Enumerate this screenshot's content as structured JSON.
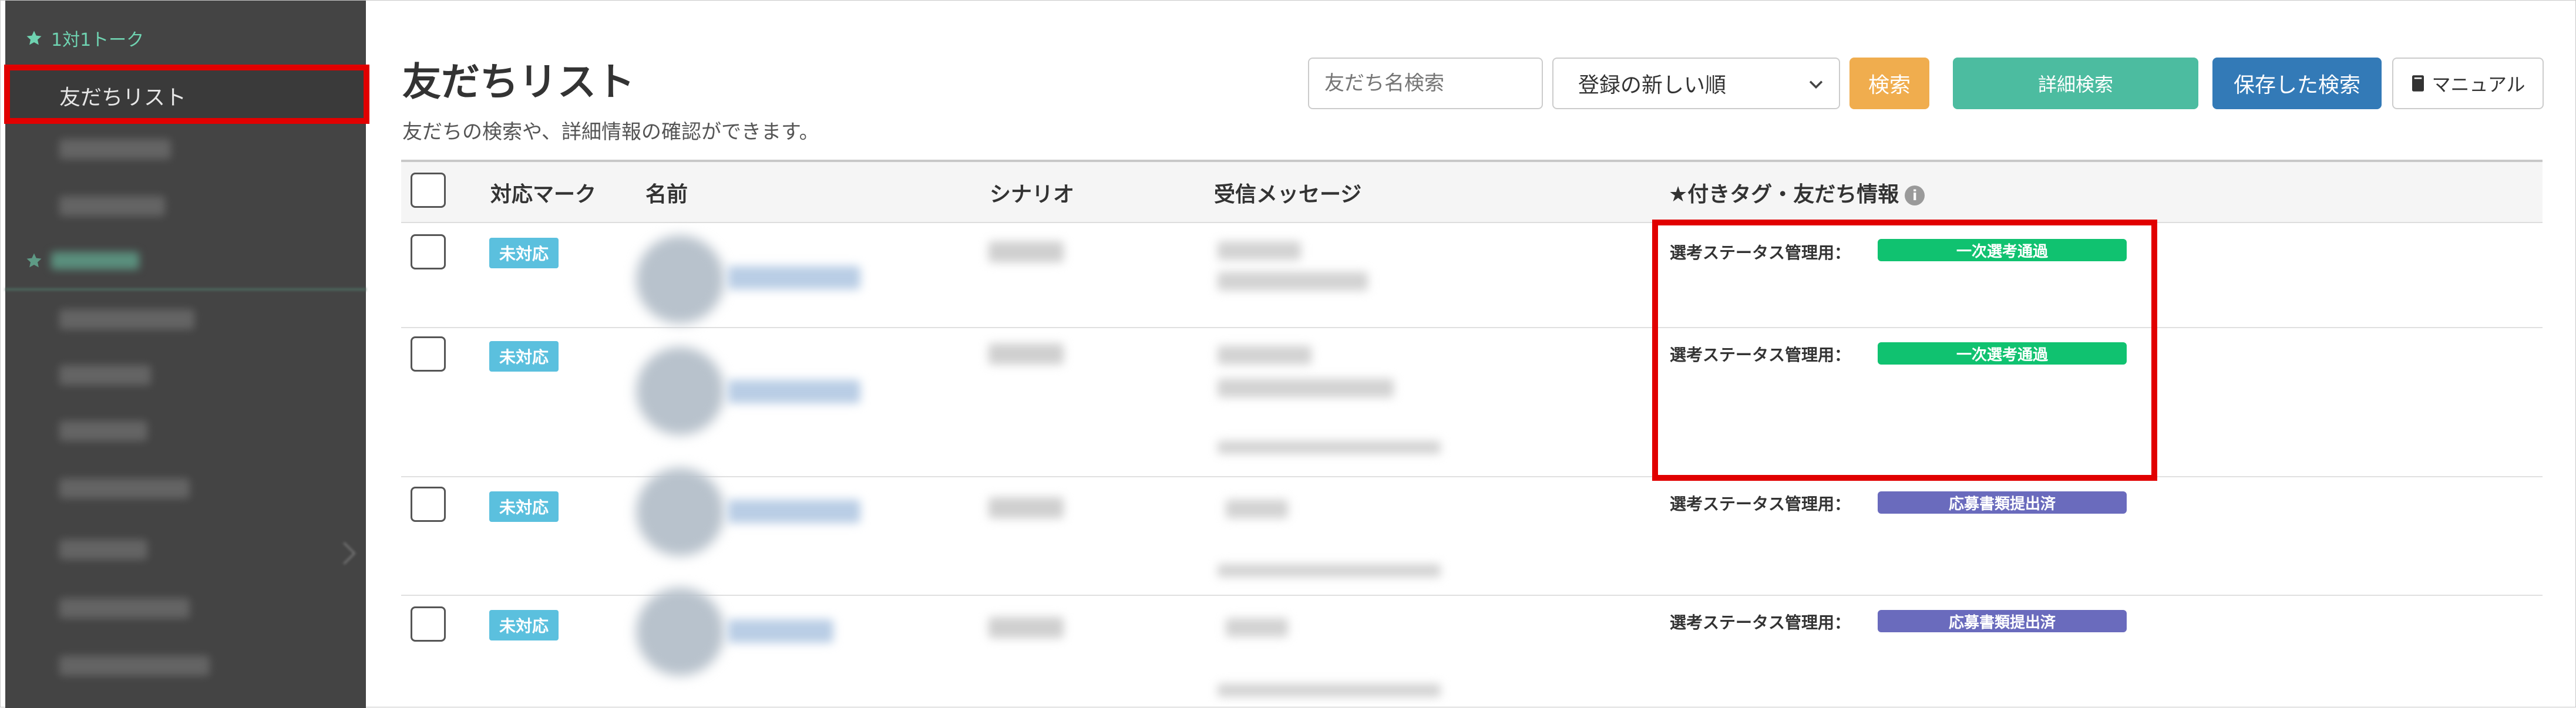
{
  "sidebar": {
    "section_talk": "1対1トーク",
    "friend_list": "友だちリスト",
    "section_message_icon": "star-icon",
    "section_talk_icon": "star-icon"
  },
  "header": {
    "title": "友だちリスト",
    "subtitle": "友だちの検索や、詳細情報の確認ができます。"
  },
  "toolbar": {
    "search_placeholder": "友だち名検索",
    "sort_selected": "登録の新しい順",
    "search_button": "検索",
    "advanced_search_button": "詳細検索",
    "saved_search_button": "保存した検索",
    "manual_button": "マニュアル"
  },
  "table": {
    "columns": [
      "対応マーク",
      "名前",
      "シナリオ",
      "受信メッセージ",
      "★付きタグ・友だち情報"
    ],
    "rows": [
      {
        "status": "未対応",
        "tag_label": "選考ステータス管理用：",
        "tag": "一次選考通過",
        "tag_color": "#10c270"
      },
      {
        "status": "未対応",
        "tag_label": "選考ステータス管理用：",
        "tag": "一次選考通過",
        "tag_color": "#10c270"
      },
      {
        "status": "未対応",
        "tag_label": "選考ステータス管理用：",
        "tag": "応募書類提出済",
        "tag_color": "#6a6bbd"
      },
      {
        "status": "未対応",
        "tag_label": "選考ステータス管理用：",
        "tag": "応募書類提出済",
        "tag_color": "#6a6bbd"
      }
    ]
  },
  "colors": {
    "highlight": "#e10000",
    "sidebar_bg": "#444444",
    "accent_green": "#4cbca0",
    "primary_blue": "#337ab7",
    "warning_orange": "#f0ad4e",
    "status_badge": "#5bc0de"
  }
}
